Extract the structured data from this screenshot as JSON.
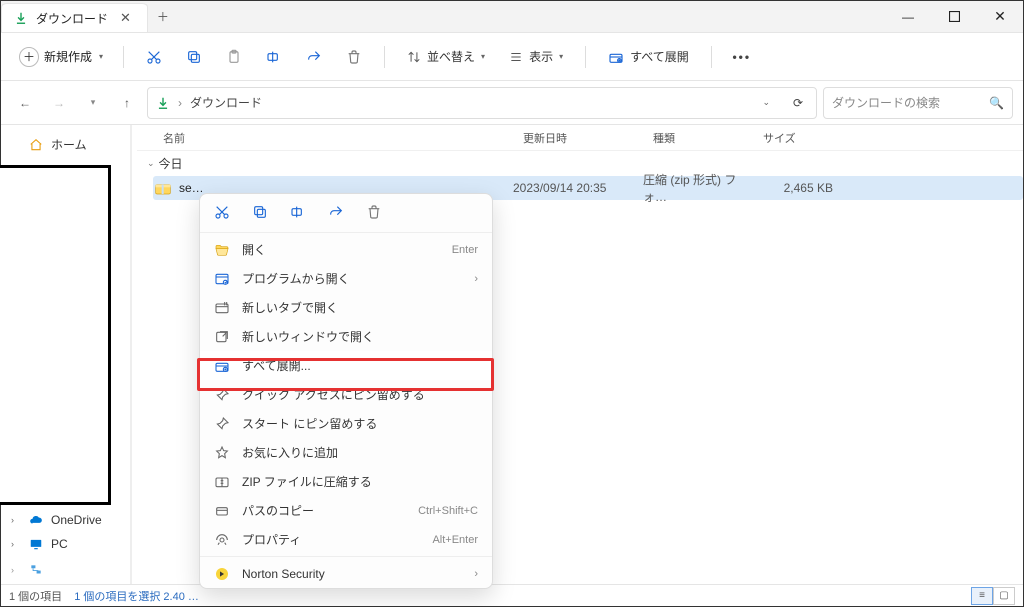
{
  "window": {
    "tab_title": "ダウンロード",
    "new_label": "新規作成",
    "sort_label": "並べ替え",
    "view_label": "表示",
    "expand_all_label": "すべて展開",
    "search_placeholder": "ダウンロードの検索"
  },
  "breadcrumb": {
    "loc": "ダウンロード"
  },
  "columns": {
    "name": "名前",
    "date": "更新日時",
    "type": "種類",
    "size": "サイズ"
  },
  "group": {
    "today": "今日"
  },
  "file": {
    "name": "se…",
    "date": "2023/09/14 20:35",
    "type": "圧縮 (zip 形式) フォ…",
    "size": "2,465 KB"
  },
  "sidebar": {
    "home": "ホーム",
    "onedrive": "OneDrive",
    "pc": "PC",
    "more": "…"
  },
  "ctx": {
    "open": "開く",
    "open_short": "Enter",
    "open_with": "プログラムから開く",
    "new_tab": "新しいタブで開く",
    "new_win": "新しいウィンドウで開く",
    "extract_all": "すべて展開...",
    "pin_quick": "クイック アクセスにピン留めする",
    "pin_start": "スタート にピン留めする",
    "fav": "お気に入りに追加",
    "zip": "ZIP ファイルに圧縮する",
    "copy_path": "パスのコピー",
    "copy_path_short": "Ctrl+Shift+C",
    "props": "プロパティ",
    "props_short": "Alt+Enter",
    "norton": "Norton Security"
  },
  "status": {
    "count": "1 個の項目",
    "selection": "1 個の項目を選択 2.40 …"
  }
}
